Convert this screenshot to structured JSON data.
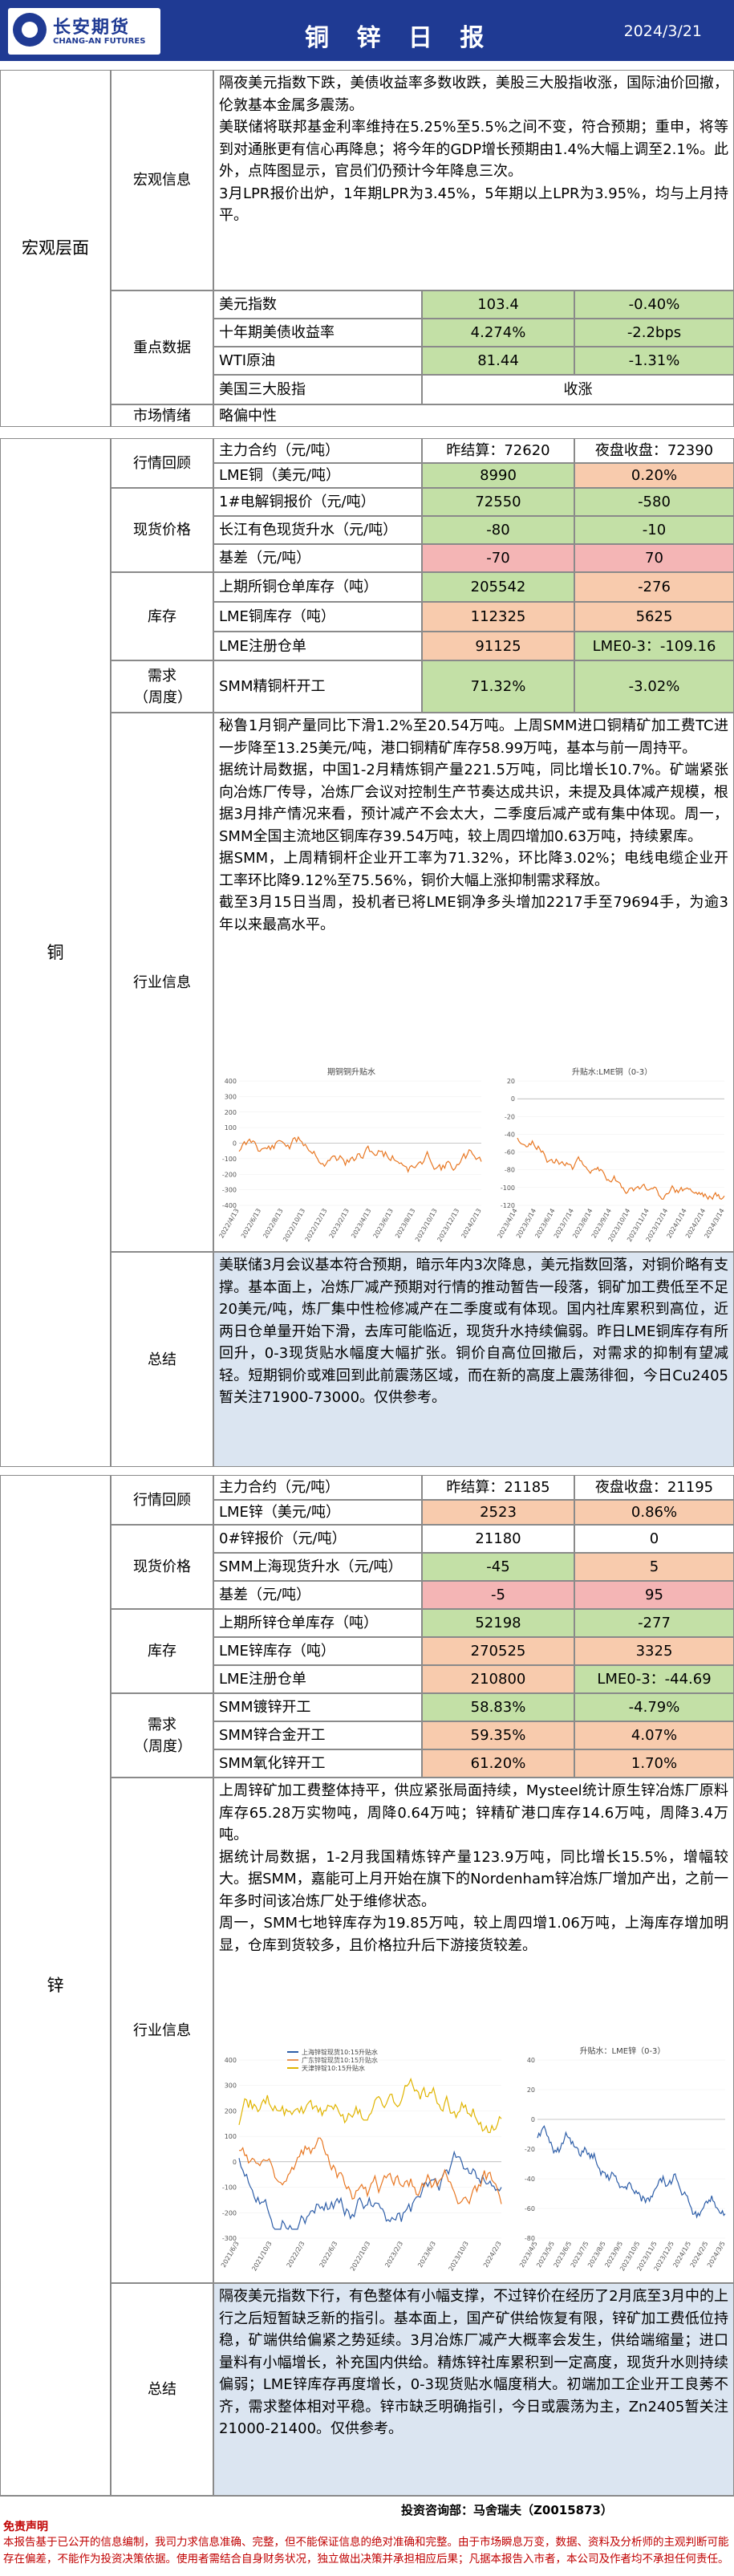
{
  "header": {
    "logo_cn": "长安期货",
    "logo_en": "CHANG-AN FUTURES",
    "title": "铜 锌 日 报",
    "date": "2024/3/21"
  },
  "macro": {
    "section": "宏观层面",
    "info_label": "宏观信息",
    "info_text": "隔夜美元指数下跌，美债收益率多数收跌，美股三大股指收涨，国际油价回撤，伦敦基本金属多震荡。\n美联储将联邦基金利率维持在5.25%至5.5%之间不变，符合预期；重申，将等到对通胀更有信心再降息；将今年的GDP增长预期由1.4%大幅上调至2.1%。此外，点阵图显示，官员们仍预计今年降息三次。\n3月LPR报价出炉，1年期LPR为3.45%，5年期以上LPR为3.95%，均与上月持平。",
    "key_label": "重点数据",
    "rows": [
      {
        "name": "美元指数",
        "value": "103.4",
        "change": "-0.40%"
      },
      {
        "name": "十年期美债收益率",
        "value": "4.274%",
        "change": "-2.2bps"
      },
      {
        "name": "WTI原油",
        "value": "81.44",
        "change": "-1.31%"
      },
      {
        "name": "美国三大股指",
        "value": "",
        "change": "收涨"
      }
    ],
    "sentiment_label": "市场情绪",
    "sentiment_value": "略偏中性"
  },
  "copper": {
    "section": "铜",
    "review_label": "行情回顾",
    "contract": "主力合约（元/吨）",
    "settle": "昨结算：72620",
    "night": "夜盘收盘：72390",
    "lme_name": "LME铜（美元/吨）",
    "lme_value": "8990",
    "lme_change": "0.20%",
    "spot_label": "现货价格",
    "spot_rows": [
      {
        "name": "1#电解铜报价（元/吨）",
        "value": "72550",
        "change": "-580"
      },
      {
        "name": "长江有色现货升水（元/吨）",
        "value": "-80",
        "change": "-10"
      },
      {
        "name": "基差（元/吨）",
        "value": "-70",
        "change": "70"
      }
    ],
    "inv_label": "库存",
    "inv_rows": [
      {
        "name": "上期所铜仓单库存（吨）",
        "value": "205542",
        "change": "-276"
      },
      {
        "name": "LME铜库存（吨）",
        "value": "112325",
        "change": "5625"
      },
      {
        "name": "LME注册仓单",
        "value": "91125",
        "change": "LME0-3：-109.16"
      }
    ],
    "demand_label": "需求（周度）",
    "demand_rows": [
      {
        "name": "SMM精铜杆开工",
        "value": "71.32%",
        "change": "-3.02%"
      }
    ],
    "industry_label": "行业信息",
    "industry_text": "秘鲁1月铜产量同比下滑1.2%至20.54万吨。上周SMM进口铜精矿加工费TC进一步降至13.25美元/吨，港口铜精矿库存58.99万吨，基本与前一周持平。\n据统计局数据，中国1-2月精炼铜产量221.5万吨，同比增长10.7%。矿端紧张向冶炼厂传导，冶炼厂会议对控制生产节奏达成共识，未提及具体减产规模，根据3月排产情况来看，预计减产不会太大，二季度后减产或有集中体现。周一，SMM全国主流地区铜库存39.54万吨，较上周四增加0.63万吨，持续累库。\n据SMM，上周精铜杆企业开工率为71.32%，环比降3.02%；电线电缆企业开工率环比降9.12%至75.56%，铜价大幅上涨抑制需求释放。\n截至3月15日当周，投机者已将LME铜净多头增加2217手至79694手，为逾3年以来最高水平。",
    "chart1_title": "期铜铜升贴水",
    "chart2_title": "升贴水:LME铜（0-3）",
    "chart1_xticks": [
      "2022/4/13",
      "2022/6/13",
      "2022/8/13",
      "2022/10/13",
      "2022/12/13",
      "2023/2/13",
      "2023/4/13",
      "2023/6/13",
      "2023/8/13",
      "2023/10/13",
      "2023/12/13",
      "2024/2/13"
    ],
    "chart1_yticks": [
      "400",
      "300",
      "200",
      "100",
      "0",
      "-100",
      "-200",
      "-300",
      "-400"
    ],
    "chart2_xticks": [
      "2023/4/14",
      "2023/5/14",
      "2023/6/14",
      "2023/7/14",
      "2023/8/14",
      "2023/9/14",
      "2023/10/14",
      "2023/11/14",
      "2023/12/14",
      "2024/1/14",
      "2024/2/14",
      "2024/3/14"
    ],
    "chart2_yticks": [
      "20",
      "0",
      "-20",
      "-40",
      "-60",
      "-80",
      "-100",
      "-120"
    ],
    "summary_label": "总结",
    "summary_text": "美联储3月会议基本符合预期，暗示年内3次降息，美元指数回落，对铜价略有支撑。基本面上，冶炼厂减产预期对行情的推动暂告一段落，铜矿加工费低至不足20美元/吨，炼厂集中性检修减产在二季度或有体现。国内社库累积到高位，近两日仓单量开始下滑，去库可能临近，现货升水持续偏弱。昨日LME铜库存有所回升，0-3现货贴水幅度大幅扩张。铜价自高位回撤后，对需求的抑制有望减轻。短期铜价或难回到此前震荡区域，而在新的高度上震荡徘徊，今日Cu2405暂关注71900-73000。仅供参考。"
  },
  "zinc": {
    "section": "锌",
    "review_label": "行情回顾",
    "contract": "主力合约（元/吨）",
    "settle": "昨结算：21185",
    "night": "夜盘收盘：21195",
    "lme_name": "LME锌（美元/吨）",
    "lme_value": "2523",
    "lme_change": "0.86%",
    "spot_label": "现货价格",
    "spot_rows": [
      {
        "name": "0#锌报价（元/吨）",
        "value": "21180",
        "change": "0"
      },
      {
        "name": "SMM上海现货升水（元/吨）",
        "value": "-45",
        "change": "5"
      },
      {
        "name": "基差（元/吨）",
        "value": "-5",
        "change": "95"
      }
    ],
    "inv_label": "库存",
    "inv_rows": [
      {
        "name": "上期所锌仓单库存（吨）",
        "value": "52198",
        "change": "-277"
      },
      {
        "name": "LME锌库存（吨）",
        "value": "270525",
        "change": "3325"
      },
      {
        "name": "LME注册仓单",
        "value": "210800",
        "change": "LME0-3：-44.69"
      }
    ],
    "demand_label": "需求（周度）",
    "demand_rows": [
      {
        "name": "SMM镀锌开工",
        "value": "58.83%",
        "change": "-4.79%"
      },
      {
        "name": "SMM锌合金开工",
        "value": "59.35%",
        "change": "4.07%"
      },
      {
        "name": "SMM氧化锌开工",
        "value": "61.20%",
        "change": "1.70%"
      }
    ],
    "industry_label": "行业信息",
    "industry_text": "上周锌矿加工费整体持平，供应紧张局面持续，Mysteel统计原生锌冶炼厂原料库存65.28万实物吨，周降0.64万吨；锌精矿港口库存14.6万吨，周降3.4万吨。\n据统计局数据，1-2月我国精炼锌产量123.9万吨，同比增长15.5%，增幅较大。据SMM，嘉能可上月开始在旗下的Nordenham锌冶炼厂增加产出，之前一年多时间该冶炼厂处于维修状态。\n周一，SMM七地锌库存为19.85万吨，较上周四增1.06万吨，上海库存增加明显，仓库到货较多，且价格拉升后下游接货较差。",
    "chart1_legend": [
      "上海锌锭现货10:15升贴水",
      "广东锌锭现货10:15升贴水",
      "天津锌锭10:15升贴水"
    ],
    "chart2_title": "升贴水：LME锌（0-3）",
    "chart1_xticks": [
      "2021/6/3",
      "2021/10/3",
      "2022/2/3",
      "2022/6/3",
      "2022/10/3",
      "2023/2/3",
      "2023/6/3",
      "2023/10/3",
      "2024/2/3"
    ],
    "chart1_yticks": [
      "400",
      "300",
      "200",
      "100",
      "0",
      "-100",
      "-200",
      "-300"
    ],
    "chart2_xticks": [
      "2023/4/5",
      "2023/5/5",
      "2023/6/5",
      "2023/7/5",
      "2023/8/5",
      "2023/9/5",
      "2023/10/5",
      "2023/11/5",
      "2023/12/5",
      "2024/1/5",
      "2024/2/5",
      "2024/3/5"
    ],
    "chart2_yticks": [
      "40",
      "20",
      "0",
      "-20",
      "-40",
      "-60",
      "-80"
    ],
    "summary_label": "总结",
    "summary_text": "隔夜美元指数下行，有色整体有小幅支撑，不过锌价在经历了2月底至3月中的上行之后短暂缺乏新的指引。基本面上，国产矿供给恢复有限，锌矿加工费低位持稳，矿端供给偏紧之势延续。3月冶炼厂减产大概率会发生，供给端缩量；进口量料有小幅增长，补充国内供给。精炼锌社库累积到一定高度，现货升水则持续偏弱；LME锌库存再度增长，0-3现货贴水幅度稍大。初端加工企业开工良莠不齐，需求整体相对平稳。锌市缺乏明确指引，今日或震荡为主，Zn2405暂关注21000-21400。仅供参考。"
  },
  "footer": {
    "contact": "投资咨询部：马舍瑞夫（Z0015873）",
    "disclaimer_title": "免责声明",
    "disclaimer": "本报告基于已公开的信息编制，我司力求信息准确、完整，但不能保证信息的绝对准确和完整。由于市场瞬息万变，数据、资料及分析师的主观判断可能存在偏差，不能作为投资决策依据。使用者需结合自身财务状况，独立做出决策并承担相应后果；凡据本报告入市者，本公司及作者均不承担任何责任。"
  },
  "colors": {
    "header": "#1f3a93",
    "label_bg": "#dbe5f1",
    "green": "#c3e0a6",
    "peach": "#f8cbad",
    "pink": "#f4b5b5",
    "chart_line": "#e87722",
    "chart_blue": "#2e5ea8"
  }
}
